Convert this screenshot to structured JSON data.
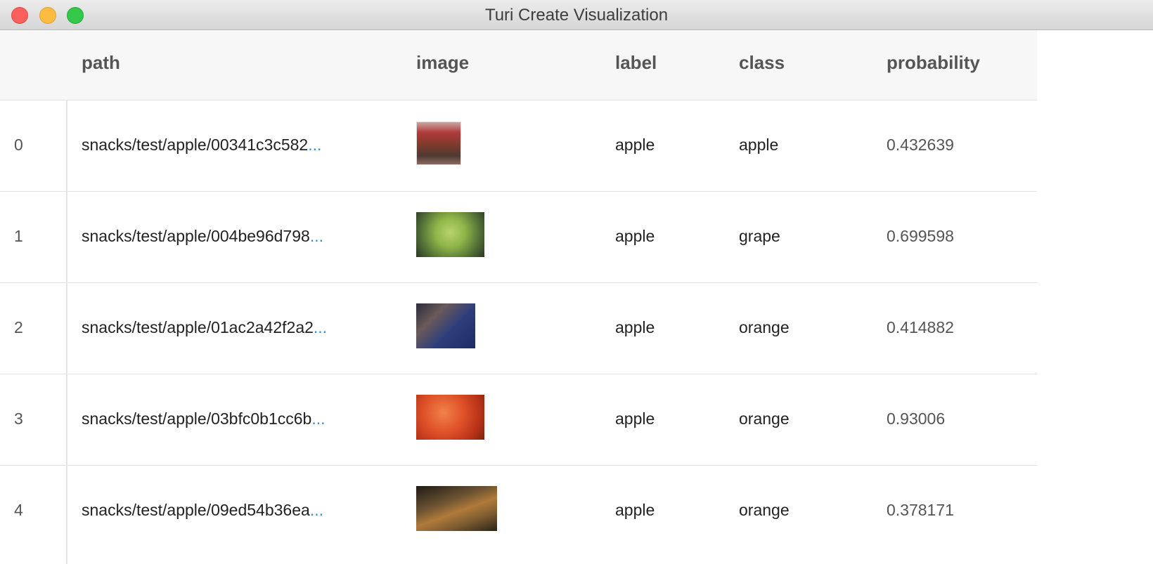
{
  "window": {
    "title": "Turi Create Visualization"
  },
  "table": {
    "columns": [
      "path",
      "image",
      "label",
      "class",
      "probability"
    ],
    "rows": [
      {
        "index": "0",
        "path": "snacks/test/apple/00341c3c582",
        "image": "image-thumbnail",
        "label": "apple",
        "class": "apple",
        "probability": "0.432639"
      },
      {
        "index": "1",
        "path": "snacks/test/apple/004be96d798",
        "image": "image-thumbnail",
        "label": "apple",
        "class": "grape",
        "probability": "0.699598"
      },
      {
        "index": "2",
        "path": "snacks/test/apple/01ac2a42f2a2",
        "image": "image-thumbnail",
        "label": "apple",
        "class": "orange",
        "probability": "0.414882"
      },
      {
        "index": "3",
        "path": "snacks/test/apple/03bfc0b1cc6b",
        "image": "image-thumbnail",
        "label": "apple",
        "class": "orange",
        "probability": "0.93006"
      },
      {
        "index": "4",
        "path": "snacks/test/apple/09ed54b36ea",
        "image": "image-thumbnail",
        "label": "apple",
        "class": "orange",
        "probability": "0.378171"
      }
    ],
    "ellipsis": "..."
  },
  "colors": {
    "link_ellipsis": "#2f8fd8",
    "header_bg": "#f7f7f7",
    "close": "#fc605c",
    "minimize": "#fdbc40",
    "maximize": "#34c84a"
  }
}
